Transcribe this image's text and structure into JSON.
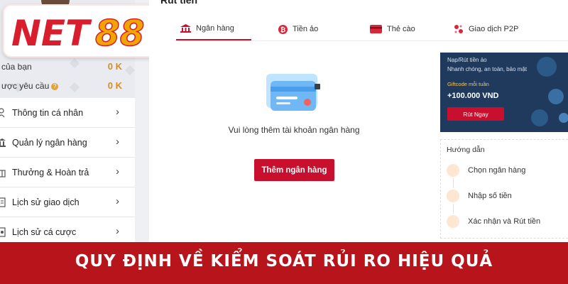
{
  "logo": {
    "text_net": "NET",
    "text_88": "88"
  },
  "balance": [
    {
      "label": "của bạn",
      "value": "0 K"
    },
    {
      "label": "ược yêu cầu",
      "value": "0 K",
      "info": "?"
    }
  ],
  "sidebar": {
    "items": [
      {
        "label": "Thông tin cá nhân",
        "icon": "user-icon"
      },
      {
        "label": "Quản lý ngân hàng",
        "icon": "bank-icon"
      },
      {
        "label": "Thưởng & Hoàn trả",
        "icon": "gift-icon"
      },
      {
        "label": "Lịch sử giao dịch",
        "icon": "history-icon"
      },
      {
        "label": "Lịch sử cá cược",
        "icon": "bet-history-icon"
      }
    ],
    "chevron": "›"
  },
  "page": {
    "title": "Rút tiền"
  },
  "tabs": [
    {
      "label": "Ngân hàng",
      "icon": "bank-icon",
      "active": true
    },
    {
      "label": "Tiền ảo",
      "icon": "crypto-icon",
      "active": false
    },
    {
      "label": "Thẻ cào",
      "icon": "card-icon",
      "active": false
    },
    {
      "label": "Giao dịch P2P",
      "icon": "p2p-icon",
      "active": false
    }
  ],
  "empty_state": {
    "message": "Vui lòng thêm tài khoản ngân hàng",
    "button": "Thêm ngân hàng"
  },
  "promo": {
    "line1": "Nạp/Rút tiền ảo",
    "line2": "Nhanh chóng, an toàn, bảo mật",
    "line3": "Giftcode mỗi tuần",
    "amount": "+100.000 VND",
    "button": "Rút Ngay"
  },
  "guide": {
    "title": "Hướng dẫn",
    "steps": [
      "Chọn ngân hàng",
      "Nhập số tiền",
      "Xác nhận và Rút tiền"
    ]
  },
  "banner": {
    "text": "QUY ĐỊNH VỀ KIỂM SOÁT RỦI RO HIỆU QUẢ"
  },
  "colors": {
    "brand_red": "#c8102e",
    "banner_red": "#b8141c",
    "balance_orange": "#d98c1a",
    "promo_navy": "#1f3a5c"
  }
}
